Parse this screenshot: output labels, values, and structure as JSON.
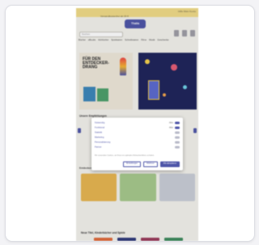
{
  "banner": {
    "utilities": "Hilfe  Mein Konto",
    "promo": "Versandkostenfrei ab 29 €"
  },
  "header": {
    "logo": "Thalia",
    "search_placeholder": "Suchen"
  },
  "nav": [
    "Bücher",
    "eBooks",
    "Hörbücher",
    "Spielwaren",
    "Schreibwaren",
    "Filme",
    "Musik",
    "Geschenke"
  ],
  "hero": {
    "headline": "FÜR DEN ENTDECKER-DRANG"
  },
  "section_title": "Unsere Empfehlungen",
  "cookie_dialog": {
    "options": [
      {
        "label": "Notwendig",
        "state": "Aktiv",
        "on": true
      },
      {
        "label": "Funktional",
        "state": "Aktiv",
        "on": true
      },
      {
        "label": "Statistik",
        "state": "",
        "on": false
      },
      {
        "label": "Marketing",
        "state": "",
        "on": false
      },
      {
        "label": "Personalisierung",
        "state": "",
        "on": false
      },
      {
        "label": "Partner",
        "state": "",
        "on": false
      }
    ],
    "note": "Wir verwenden Cookies, um Ihnen ein optimales Einkaufserlebnis zu bieten.",
    "buttons": {
      "settings": "Einstellungen",
      "decline": "Ablehnen",
      "accept": "Alle akzeptieren"
    }
  },
  "mid_title": "Entdecken",
  "bottom_heading": "Neue Titel, Kinderbücher und Spiele",
  "colors": {
    "brand": "#4e55a8",
    "banner": "#f1dc87"
  }
}
